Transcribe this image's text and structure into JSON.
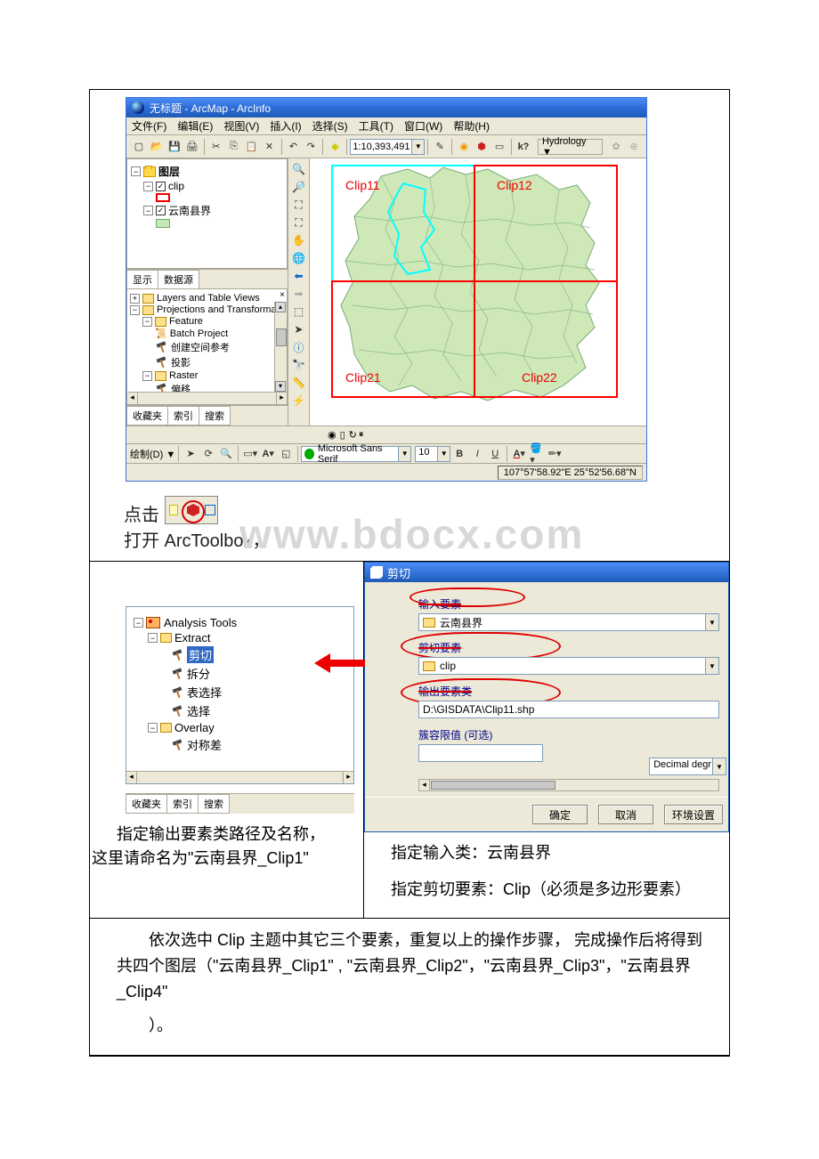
{
  "arcmap": {
    "title": "无标题 - ArcMap - ArcInfo",
    "menu": {
      "file": "文件(F)",
      "edit": "编辑(E)",
      "view": "视图(V)",
      "insert": "插入(I)",
      "select": "选择(S)",
      "tools": "工具(T)",
      "window": "窗口(W)",
      "help": "帮助(H)"
    },
    "scale": "1:10,393,491",
    "hydrology": "Hydrology ▼",
    "toc": {
      "root": "图层",
      "clip": "clip",
      "yn": "云南县界",
      "tab_display": "显示",
      "tab_source": "数据源"
    },
    "toolbox": {
      "layers_views": "Layers and Table Views",
      "proj": "Projections and Transformat",
      "feature": "Feature",
      "batch": "Batch Project",
      "create_sr": "创建空间参考",
      "project": "投影",
      "raster": "Raster",
      "offset": "偏移"
    },
    "fav_tabs": {
      "fav": "收藏夹",
      "index": "索引",
      "search": "搜索"
    },
    "draw_label": "绘制(D) ▼",
    "font": "Microsoft Sans Serif",
    "fontsize": "10",
    "coord": "107°57'58.92\"E  25°52'56.68\"N",
    "map_labels": {
      "c11": "Clip11",
      "c12": "Clip12",
      "c21": "Clip21",
      "c22": "Clip22"
    }
  },
  "mid": {
    "click": "点击",
    "open": "打开 ArcToolbox，",
    "watermark": "www.bdocx.com"
  },
  "atb": {
    "analysis": "Analysis Tools",
    "extract": "Extract",
    "clip": "剪切",
    "split": "拆分",
    "tselect": "表选择",
    "select": "选择",
    "overlay": "Overlay",
    "symdiff": "对称差",
    "fav": "收藏夹",
    "index": "索引",
    "search": "搜索"
  },
  "clip_dlg": {
    "title": "剪切",
    "in_label": "输入要素",
    "in_val": "云南县界",
    "clip_label": "剪切要素",
    "clip_val": "clip",
    "out_label": "输出要素类",
    "out_val": "D:\\GISDATA\\Clip11.shp",
    "tol_label": "簇容限值 (可选)",
    "unit": "Decimal degr",
    "ok": "确定",
    "cancel": "取消",
    "env": "环境设置"
  },
  "desc": {
    "left1": "指定输出要素类路径及名称，",
    "left2": "这里请命名为\"云南县界_Clip1\"",
    "right1": "指定输入类：云南县界",
    "right2": "指定剪切要素：Clip（必须是多边形要素）"
  },
  "row3": {
    "p1": "依次选中 Clip 主题中其它三个要素，重复以上的操作步骤， 完成操作后将得到共四个图层（\"云南县界_Clip1\" , \"云南县界_Clip2\"，\"云南县界_Clip3\"，\"云南县界_Clip4\"",
    "p2": "）。"
  }
}
